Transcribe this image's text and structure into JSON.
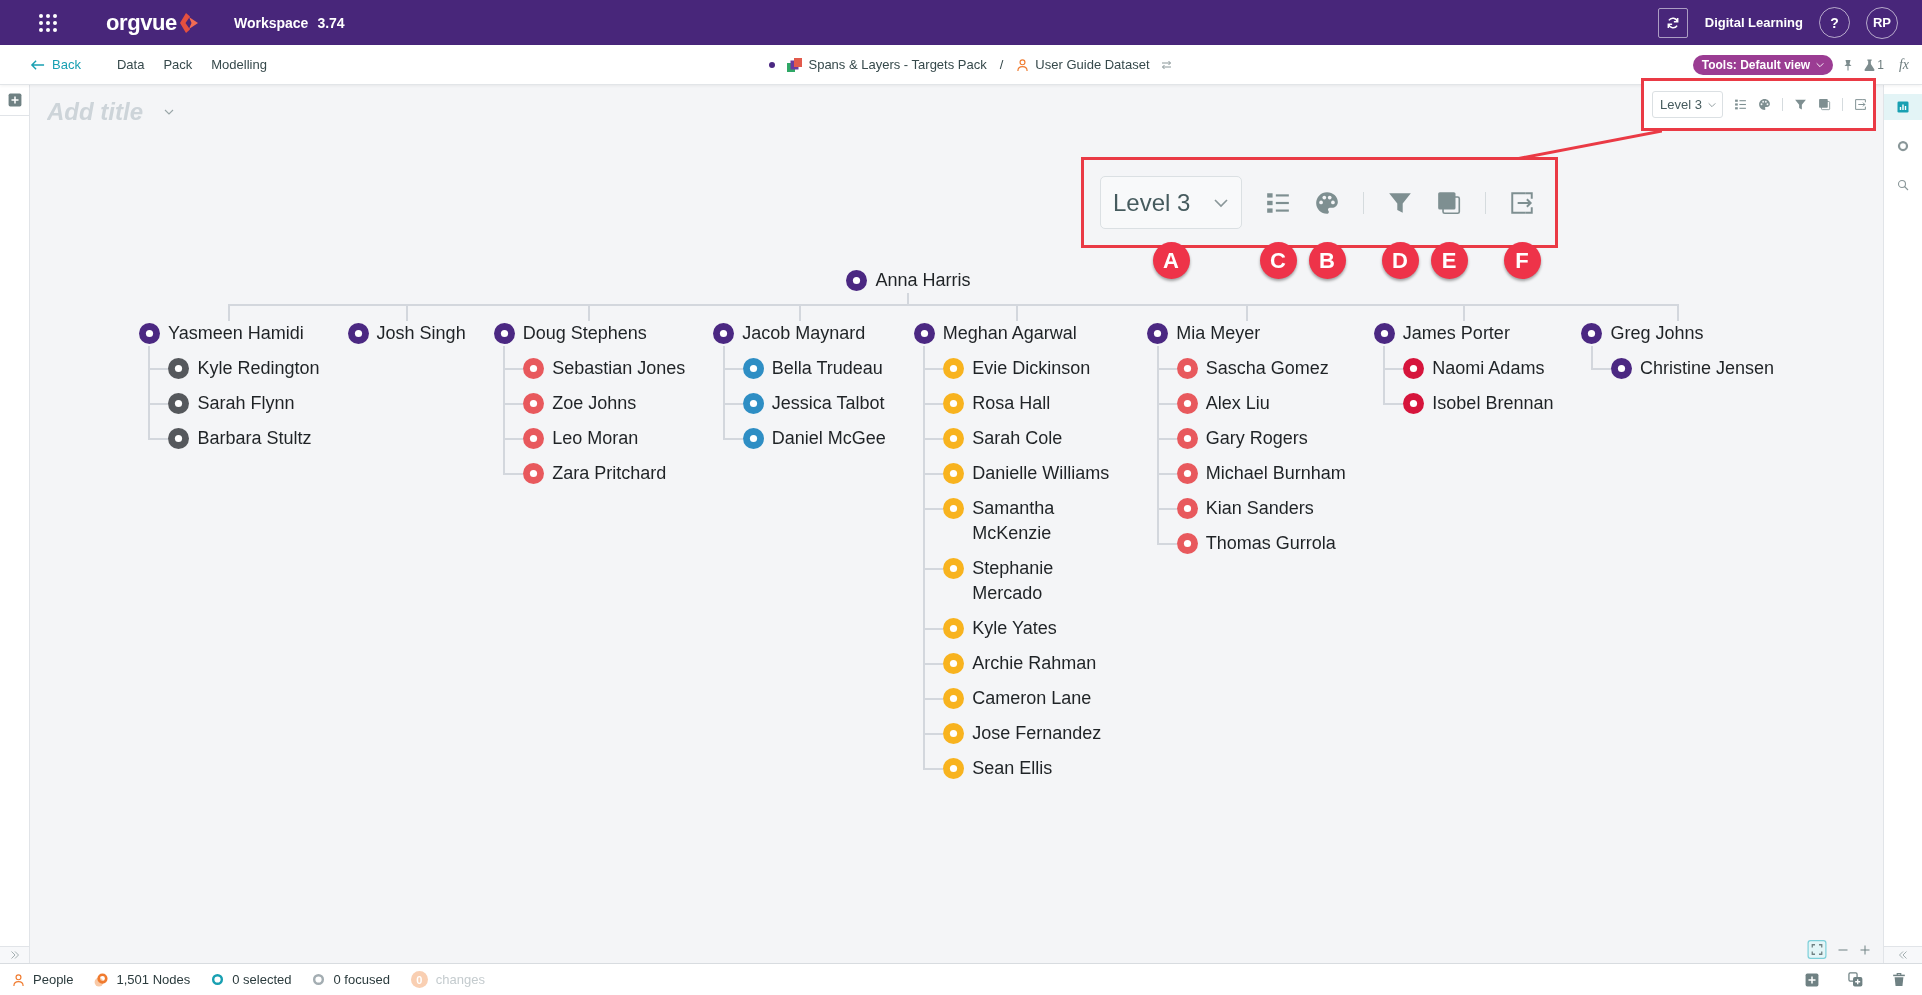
{
  "top_bar": {
    "logo_text": "orgvue",
    "app_name": "Workspace",
    "version": "3.74",
    "user_label": "Digital Learning",
    "help": "?",
    "avatar": "RP"
  },
  "nav_bar": {
    "back": "Back",
    "menu": [
      "Data",
      "Pack",
      "Modelling"
    ],
    "breadcrumb": [
      {
        "kind": "pack",
        "label": "Spans & Layers - Targets Pack"
      },
      {
        "kind": "dataset",
        "label": "User Guide Dataset"
      }
    ],
    "separator": "/",
    "tools_button": "Tools: Default view",
    "flask_count": "1",
    "formula": "fx"
  },
  "canvas": {
    "title": {
      "placeholder": "Add title"
    },
    "toolbar": {
      "level": "Level 3"
    },
    "callout": {
      "level": "Level 3",
      "badges": [
        "A",
        "C",
        "B",
        "D",
        "E",
        "F"
      ]
    },
    "org_chart": {
      "name": "Anna Harris",
      "color": "#4b2882",
      "children": [
        {
          "name": "Yasmeen Hamidi",
          "color": "#4b2882",
          "children": [
            {
              "name": "Kyle Redington",
              "color": "#55585c"
            },
            {
              "name": "Sarah Flynn",
              "color": "#55585c"
            },
            {
              "name": "Barbara Stultz",
              "color": "#55585c"
            }
          ]
        },
        {
          "name": "Josh Singh",
          "color": "#4b2882"
        },
        {
          "name": "Doug Stephens",
          "color": "#4b2882",
          "children": [
            {
              "name": "Sebastian Jones",
              "color": "#e8595d"
            },
            {
              "name": "Zoe Johns",
              "color": "#e8595d"
            },
            {
              "name": "Leo Moran",
              "color": "#e8595d"
            },
            {
              "name": "Zara Pritchard",
              "color": "#e8595d"
            }
          ]
        },
        {
          "name": "Jacob Maynard",
          "color": "#4b2882",
          "children": [
            {
              "name": "Bella Trudeau",
              "color": "#2e8ec4"
            },
            {
              "name": "Jessica Talbot",
              "color": "#2e8ec4"
            },
            {
              "name": "Daniel McGee",
              "color": "#2e8ec4"
            }
          ]
        },
        {
          "name": "Meghan Agarwal",
          "color": "#4b2882",
          "children": [
            {
              "name": "Evie Dickinson",
              "color": "#f8b31f"
            },
            {
              "name": "Rosa Hall",
              "color": "#f8b31f"
            },
            {
              "name": "Sarah Cole",
              "color": "#f8b31f"
            },
            {
              "name": "Danielle Williams",
              "color": "#f8b31f"
            },
            {
              "name": "Samantha McKenzie",
              "color": "#f8b31f"
            },
            {
              "name": "Stephanie Mercado",
              "color": "#f8b31f"
            },
            {
              "name": "Kyle Yates",
              "color": "#f8b31f"
            },
            {
              "name": "Archie Rahman",
              "color": "#f8b31f"
            },
            {
              "name": "Cameron Lane",
              "color": "#f8b31f"
            },
            {
              "name": "Jose Fernandez",
              "color": "#f8b31f"
            },
            {
              "name": "Sean Ellis",
              "color": "#f8b31f"
            }
          ]
        },
        {
          "name": "Mia Meyer",
          "color": "#4b2882",
          "children": [
            {
              "name": "Sascha Gomez",
              "color": "#e8595d"
            },
            {
              "name": "Alex Liu",
              "color": "#e8595d"
            },
            {
              "name": "Gary Rogers",
              "color": "#e8595d"
            },
            {
              "name": "Michael Burnham",
              "color": "#e8595d"
            },
            {
              "name": "Kian Sanders",
              "color": "#e8595d"
            },
            {
              "name": "Thomas Gurrola",
              "color": "#e8595d"
            }
          ]
        },
        {
          "name": "James Porter",
          "color": "#4b2882",
          "children": [
            {
              "name": "Naomi Adams",
              "color": "#d6153c"
            },
            {
              "name": "Isobel Brennan",
              "color": "#d6153c"
            }
          ]
        },
        {
          "name": "Greg Johns",
          "color": "#4b2882",
          "children": [
            {
              "name": "Christine Jensen",
              "color": "#4b2882"
            }
          ]
        }
      ]
    }
  },
  "side_panel": {
    "tabs": [
      {
        "kind": "chart",
        "selected": true
      },
      {
        "kind": "ring",
        "selected": false
      },
      {
        "kind": "search",
        "selected": false
      }
    ]
  },
  "status_bar": {
    "items": [
      {
        "kind": "people",
        "label": "People",
        "disabled": false
      },
      {
        "kind": "nodes",
        "label": "1,501 Nodes",
        "disabled": false
      },
      {
        "kind": "selected",
        "label": "0 selected",
        "disabled": false
      },
      {
        "kind": "focused",
        "label": "0 focused",
        "disabled": false
      },
      {
        "kind": "changes",
        "count": "0",
        "label": "changes",
        "disabled": true
      }
    ]
  }
}
